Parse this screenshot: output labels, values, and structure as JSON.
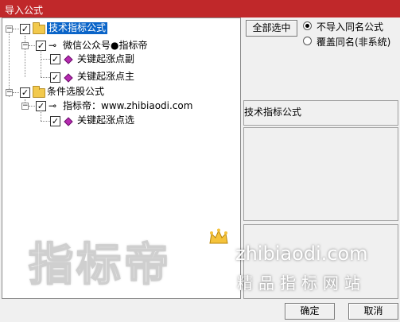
{
  "window": {
    "title": "导入公式"
  },
  "tree": {
    "groups": [
      {
        "label": "技术指标公式",
        "checked": "✓",
        "expander": "−",
        "children": [
          {
            "label": "微信公众号●指标帝",
            "checked": "✓",
            "expander": "−",
            "items": [
              {
                "label": "关键起涨点副",
                "checked": "✓"
              },
              {
                "label": "关键起涨点主",
                "checked": "✓"
              }
            ]
          }
        ]
      },
      {
        "label": "条件选股公式",
        "checked": "✓",
        "expander": "−",
        "children": [
          {
            "label": "指标帝：www.zhibiaodi.com",
            "checked": "✓",
            "expander": "−",
            "items": [
              {
                "label": "关键起涨点选",
                "checked": "✓"
              }
            ]
          }
        ]
      }
    ],
    "key_glyph": "⊸"
  },
  "options": {
    "select_all_label": "全部选中",
    "radio_no_import": "不导入同名公式",
    "radio_overwrite": "覆盖同名(非系统)"
  },
  "info": {
    "title": "技术指标公式"
  },
  "footer": {
    "ok_label": "确定",
    "cancel_label": "取消"
  },
  "watermark": {
    "big": "指标帝",
    "url": "zhibiaodi.com",
    "sub": "精品指标网站"
  }
}
